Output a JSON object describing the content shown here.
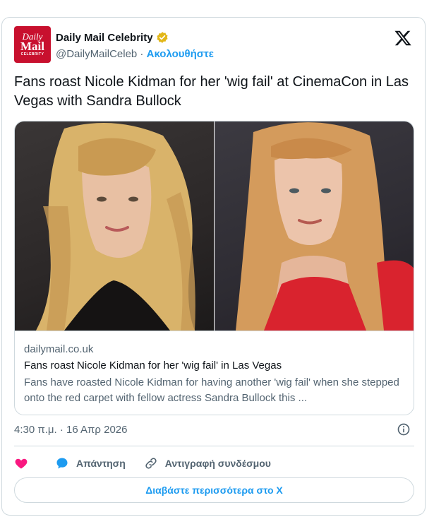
{
  "author": {
    "display_name": "Daily Mail Celebrity",
    "handle": "@DailyMailCeleb",
    "separator": " · ",
    "follow_label": "Ακολουθήστε",
    "avatar_logo": {
      "line1": "Daily",
      "line2": "Mail",
      "line3": "CELEBRITY"
    }
  },
  "tweet": {
    "text": "Fans roast Nicole Kidman for her 'wig fail' at CinemaCon in Las Vegas with Sandra Bullock"
  },
  "link_card": {
    "domain": "dailymail.co.uk",
    "title": "Fans roast Nicole Kidman for her 'wig fail' in Las Vegas",
    "description": "Fans have roasted Nicole Kidman for having another 'wig fail' when she stepped onto the red carpet with fellow actress Sandra Bullock this ...",
    "images": [
      "photo-left",
      "photo-right"
    ]
  },
  "meta": {
    "timestamp": "4:30 π.μ. · 16 Απρ 2026"
  },
  "actions": {
    "reply_label": "Απάντηση",
    "copy_link_label": "Αντιγραφή συνδέσμου"
  },
  "read_more_label": "Διαβάστε περισσότερα στο X",
  "colors": {
    "accent": "#1d9bf0",
    "like": "#f91880",
    "brand": "#c8102e",
    "verified": "#e2b719",
    "text_secondary": "#536471",
    "border": "#cfd9de"
  },
  "icons": [
    "verified-badge-icon",
    "x-logo-icon",
    "info-icon",
    "heart-icon",
    "reply-bubble-icon",
    "link-icon"
  ]
}
